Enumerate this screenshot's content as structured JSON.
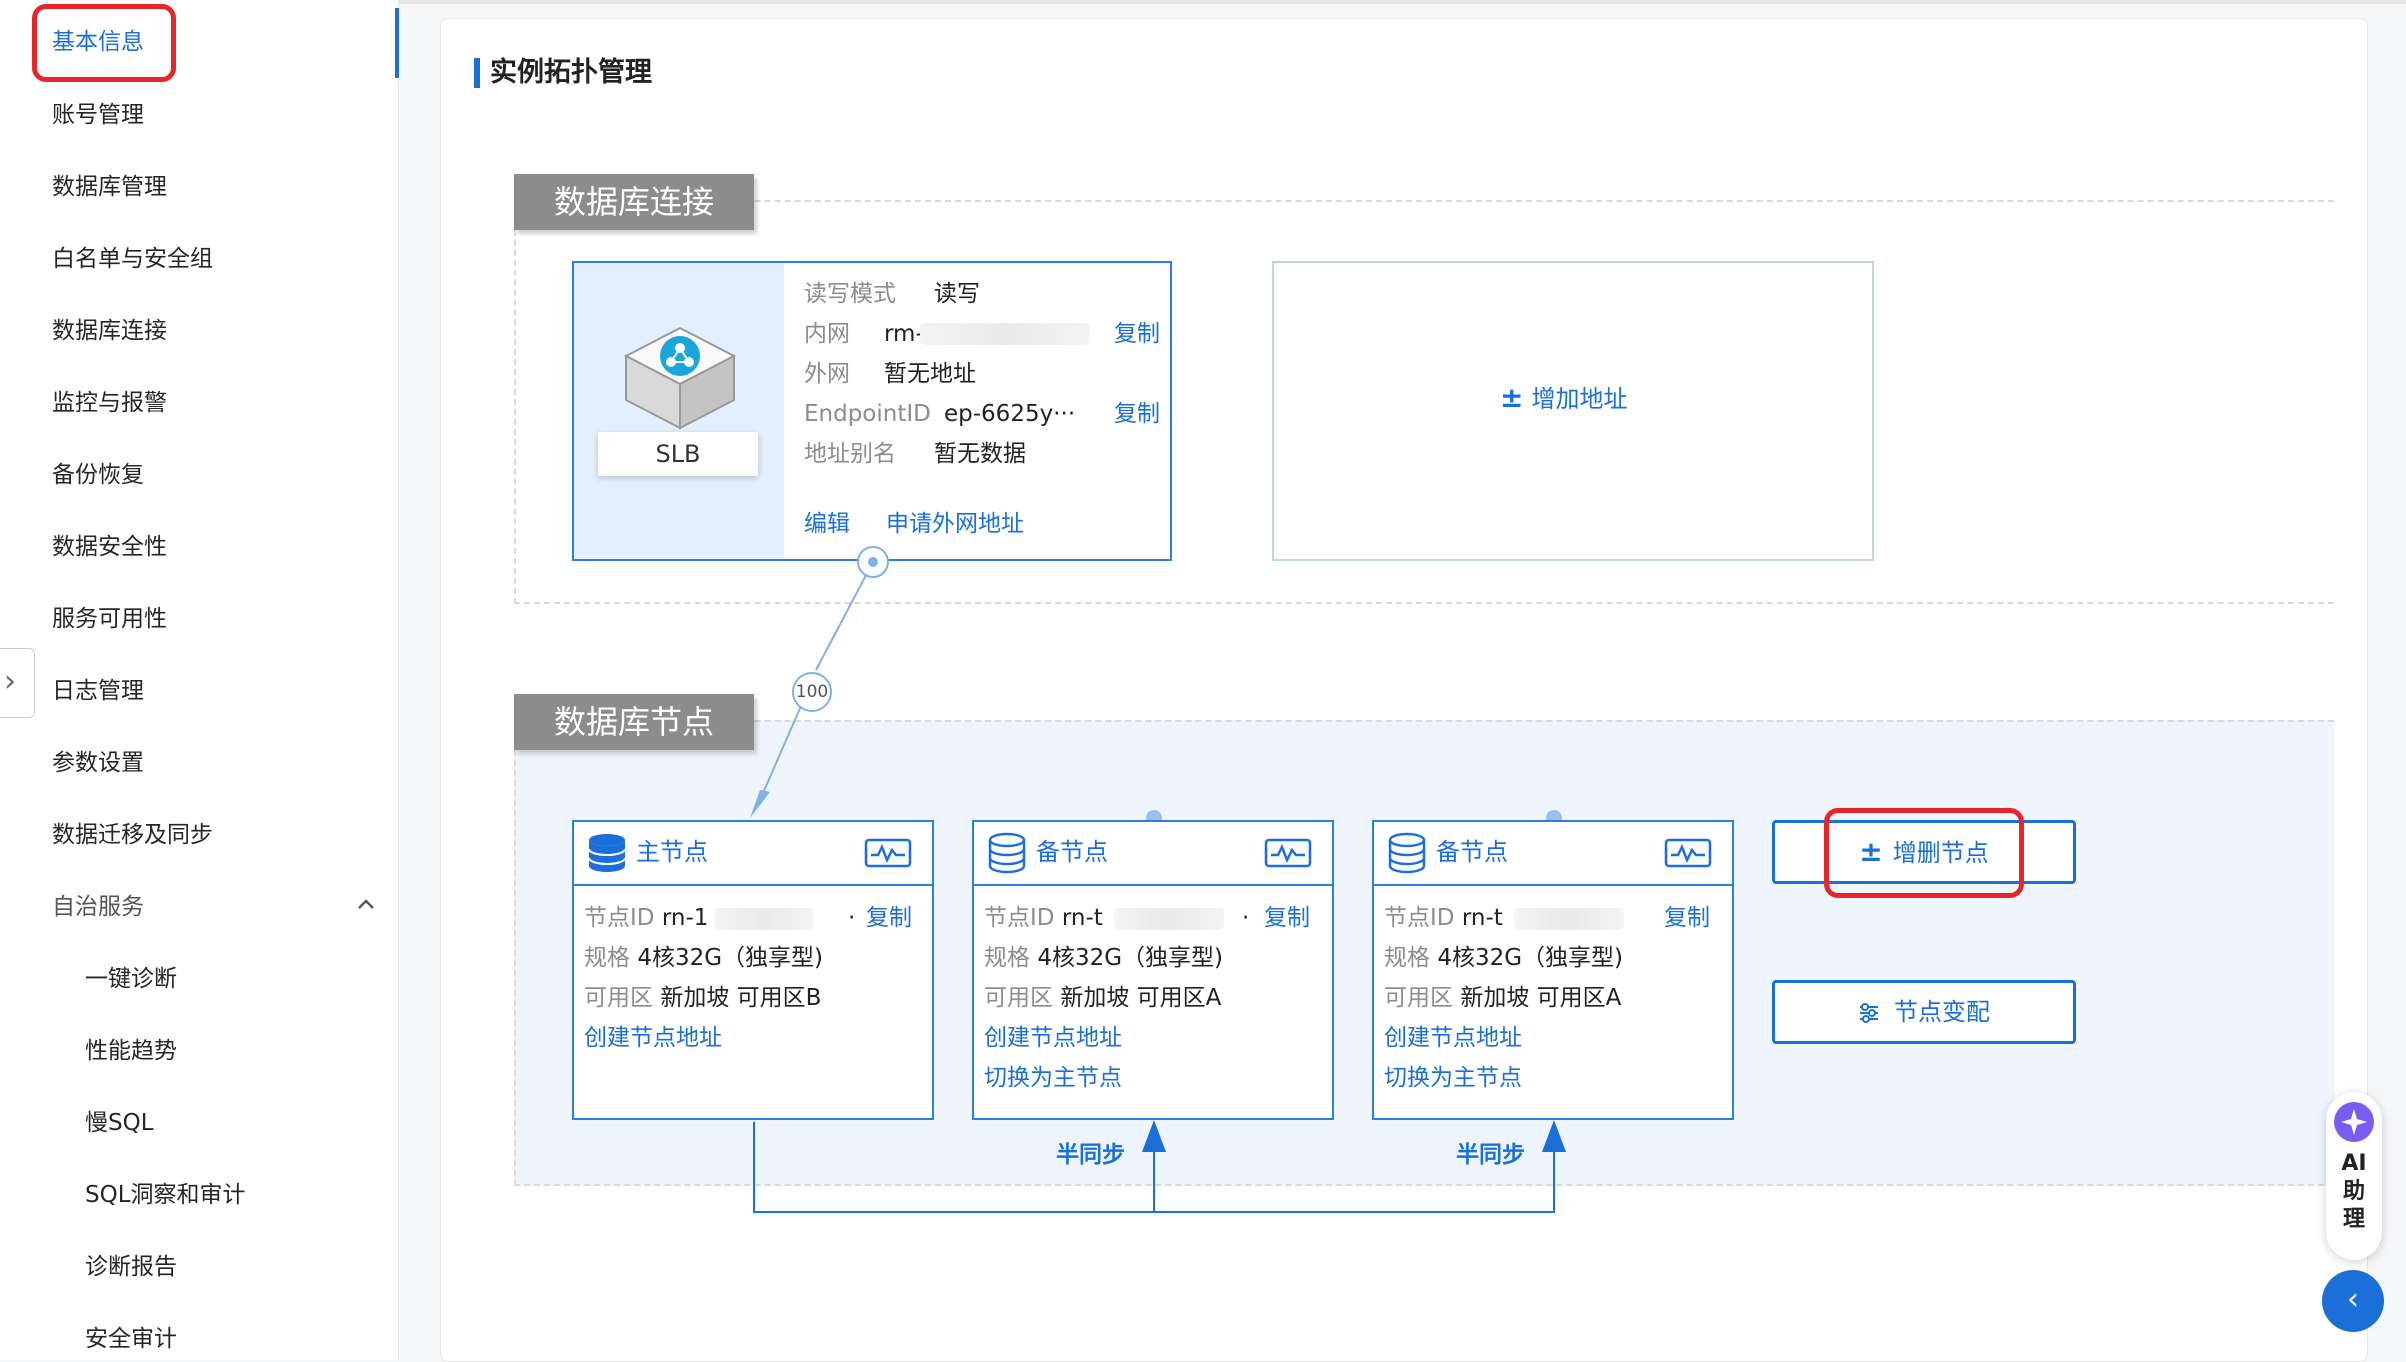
{
  "sidebar": {
    "items": [
      {
        "label": "基本信息"
      },
      {
        "label": "账号管理"
      },
      {
        "label": "数据库管理"
      },
      {
        "label": "白名单与安全组"
      },
      {
        "label": "数据库连接"
      },
      {
        "label": "监控与报警"
      },
      {
        "label": "备份恢复"
      },
      {
        "label": "数据安全性"
      },
      {
        "label": "服务可用性"
      },
      {
        "label": "日志管理"
      },
      {
        "label": "参数设置"
      },
      {
        "label": "数据迁移及同步"
      },
      {
        "label": "自治服务"
      }
    ],
    "sub_items": [
      {
        "label": "一键诊断"
      },
      {
        "label": "性能趋势"
      },
      {
        "label": "慢SQL"
      },
      {
        "label": "SQL洞察和审计"
      },
      {
        "label": "诊断报告"
      },
      {
        "label": "安全审计"
      }
    ]
  },
  "main": {
    "title": "实例拓扑管理",
    "connection_zone": {
      "tag": "数据库连接",
      "slb": {
        "label": "SLB",
        "rw_mode_key": "读写模式",
        "rw_mode_val": "读写",
        "intranet_key": "内网",
        "intranet_val": "rm-",
        "intranet_copy": "复制",
        "internet_key": "外网",
        "internet_val": "暂无地址",
        "endpoint_key": "EndpointID",
        "endpoint_val": "ep-6625y···",
        "endpoint_copy": "复制",
        "alias_key": "地址别名",
        "alias_val": "暂无数据",
        "edit": "编辑",
        "apply_public": "申请外网地址"
      },
      "add_address": "增加地址"
    },
    "weight": "100",
    "nodes_zone": {
      "tag": "数据库节点",
      "nodes": [
        {
          "title": "主节点",
          "id_key": "节点ID",
          "id_val": "rn-1",
          "id_suffix": "·",
          "copy": "复制",
          "spec_key": "规格",
          "spec_val": "4核32G（独享型)",
          "zone_key": "可用区",
          "zone_val": "新加坡 可用区B",
          "create_addr": "创建节点地址",
          "switch": ""
        },
        {
          "title": "备节点",
          "id_key": "节点ID",
          "id_val": "rn-t",
          "id_suffix": "·",
          "copy": "复制",
          "spec_key": "规格",
          "spec_val": "4核32G（独享型)",
          "zone_key": "可用区",
          "zone_val": "新加坡 可用区A",
          "create_addr": "创建节点地址",
          "switch": "切换为主节点"
        },
        {
          "title": "备节点",
          "id_key": "节点ID",
          "id_val": "rn-t",
          "id_suffix": "",
          "copy": "复制",
          "spec_key": "规格",
          "spec_val": "4核32G（独享型)",
          "zone_key": "可用区",
          "zone_val": "新加坡 可用区A",
          "create_addr": "创建节点地址",
          "switch": "切换为主节点"
        }
      ],
      "add_remove_nodes": "增删节点",
      "node_config_change": "节点变配",
      "sync_label_1": "半同步",
      "sync_label_2": "半同步"
    }
  },
  "assistant": {
    "label_line1": "AI",
    "label_line2": "助",
    "label_line3": "理",
    "collapse": "‹"
  },
  "colors": {
    "accent": "#1a6fd8",
    "highlight": "#e8262a",
    "zone_tag": "#8c8c8c"
  }
}
